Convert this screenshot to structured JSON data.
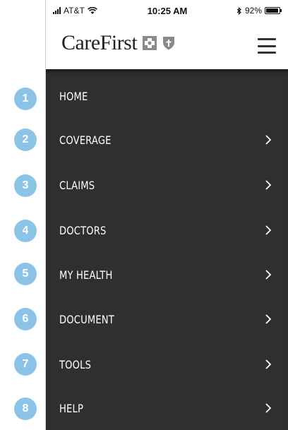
{
  "status_bar": {
    "carrier": "AT&T",
    "time": "10:25 AM",
    "battery_text": "92%",
    "battery_level": 0.92
  },
  "header": {
    "logo_text": "CareFirst"
  },
  "menu": {
    "items": [
      {
        "label": "HOME",
        "has_chevron": false
      },
      {
        "label": "COVERAGE",
        "has_chevron": true
      },
      {
        "label": "CLAIMS",
        "has_chevron": true
      },
      {
        "label": "DOCTORS",
        "has_chevron": true
      },
      {
        "label": "MY HEALTH",
        "has_chevron": true
      },
      {
        "label": "DOCUMENT",
        "has_chevron": true
      },
      {
        "label": "TOOLS",
        "has_chevron": true
      },
      {
        "label": "HELP",
        "has_chevron": true
      }
    ]
  },
  "badges": [
    "1",
    "2",
    "3",
    "4",
    "5",
    "6",
    "7",
    "8"
  ],
  "colors": {
    "menu_background": "#2f2f2f",
    "badge": "#8cc4e8",
    "logo_blue": "#1f5fa8"
  }
}
